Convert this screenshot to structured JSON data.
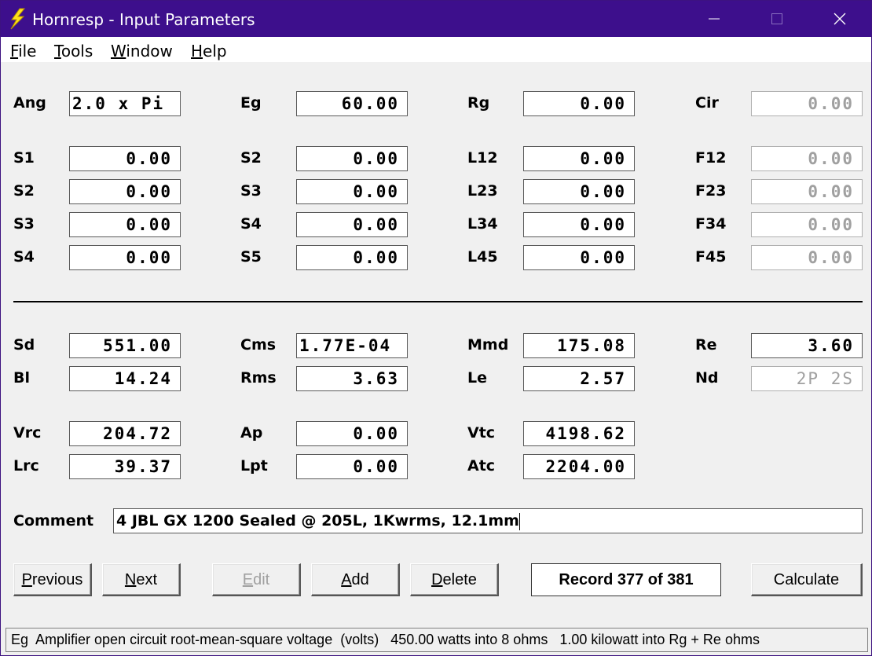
{
  "window": {
    "title": "Hornresp - Input Parameters",
    "title_color": "#3d0f8c"
  },
  "menu": [
    {
      "mnemonic": "F",
      "rest": "ile"
    },
    {
      "mnemonic": "T",
      "rest": "ools"
    },
    {
      "mnemonic": "W",
      "rest": "indow"
    },
    {
      "mnemonic": "H",
      "rest": "elp"
    }
  ],
  "params": {
    "ang": {
      "label": "Ang",
      "value": "2.0 x Pi"
    },
    "eg": {
      "label": "Eg",
      "value": "60.00"
    },
    "rg": {
      "label": "Rg",
      "value": "0.00"
    },
    "cir": {
      "label": "Cir",
      "value": "0.00"
    },
    "row1": [
      {
        "label": "S1",
        "value": "0.00"
      },
      {
        "label": "S2",
        "value": "0.00"
      },
      {
        "label": "L12",
        "value": "0.00"
      },
      {
        "label": "F12",
        "value": "0.00"
      }
    ],
    "row2": [
      {
        "label": "S2",
        "value": "0.00"
      },
      {
        "label": "S3",
        "value": "0.00"
      },
      {
        "label": "L23",
        "value": "0.00"
      },
      {
        "label": "F23",
        "value": "0.00"
      }
    ],
    "row3": [
      {
        "label": "S3",
        "value": "0.00"
      },
      {
        "label": "S4",
        "value": "0.00"
      },
      {
        "label": "L34",
        "value": "0.00"
      },
      {
        "label": "F34",
        "value": "0.00"
      }
    ],
    "row4": [
      {
        "label": "S4",
        "value": "0.00"
      },
      {
        "label": "S5",
        "value": "0.00"
      },
      {
        "label": "L45",
        "value": "0.00"
      },
      {
        "label": "F45",
        "value": "0.00"
      }
    ]
  },
  "driver": {
    "sd": {
      "label": "Sd",
      "value": "551.00"
    },
    "cms": {
      "label": "Cms",
      "value": "1.77E-04"
    },
    "mmd": {
      "label": "Mmd",
      "value": "175.08"
    },
    "re": {
      "label": "Re",
      "value": "3.60"
    },
    "bl": {
      "label": "Bl",
      "value": "14.24"
    },
    "rms": {
      "label": "Rms",
      "value": "3.63"
    },
    "le": {
      "label": "Le",
      "value": "2.57"
    },
    "nd": {
      "label": "Nd",
      "value": "2P 2S"
    }
  },
  "chamber": {
    "vrc": {
      "label": "Vrc",
      "value": "204.72"
    },
    "ap": {
      "label": "Ap",
      "value": "0.00"
    },
    "vtc": {
      "label": "Vtc",
      "value": "4198.62"
    },
    "lrc": {
      "label": "Lrc",
      "value": "39.37"
    },
    "lpt": {
      "label": "Lpt",
      "value": "0.00"
    },
    "atc": {
      "label": "Atc",
      "value": "2204.00"
    }
  },
  "comment": {
    "label": "Comment",
    "value": "4 JBL GX 1200 Sealed @ 205L, 1Kwrms, 12.1mm"
  },
  "buttons": {
    "previous": {
      "mnemonic": "P",
      "rest": "revious"
    },
    "next": {
      "mnemonic": "N",
      "rest": "ext"
    },
    "edit": {
      "mnemonic": "E",
      "rest": "dit"
    },
    "add": {
      "mnemonic": "A",
      "rest": "dd"
    },
    "delete": {
      "mnemonic": "D",
      "rest": "elete"
    },
    "calculate": "Calculate"
  },
  "record": "Record 377 of 381",
  "status": "Eg  Amplifier open circuit root-mean-square voltage  (volts)   450.00 watts into 8 ohms   1.00 kilowatt into Rg + Re ohms"
}
